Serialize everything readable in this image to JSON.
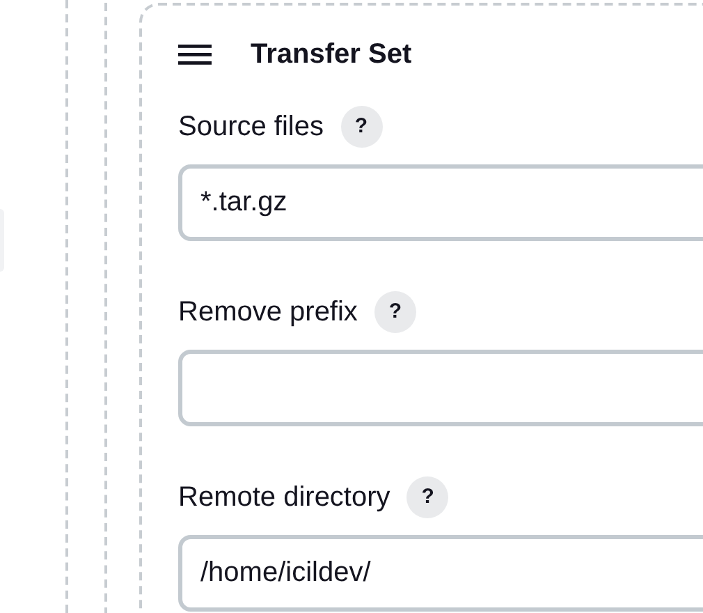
{
  "section": {
    "title": "Transfer Set",
    "fields": [
      {
        "label": "Source files",
        "help": "?",
        "value": "*.tar.gz"
      },
      {
        "label": "Remove prefix",
        "help": "?"
      },
      {
        "label": "Remote directory",
        "help": "?",
        "value": "/home/icildev/"
      }
    ]
  }
}
